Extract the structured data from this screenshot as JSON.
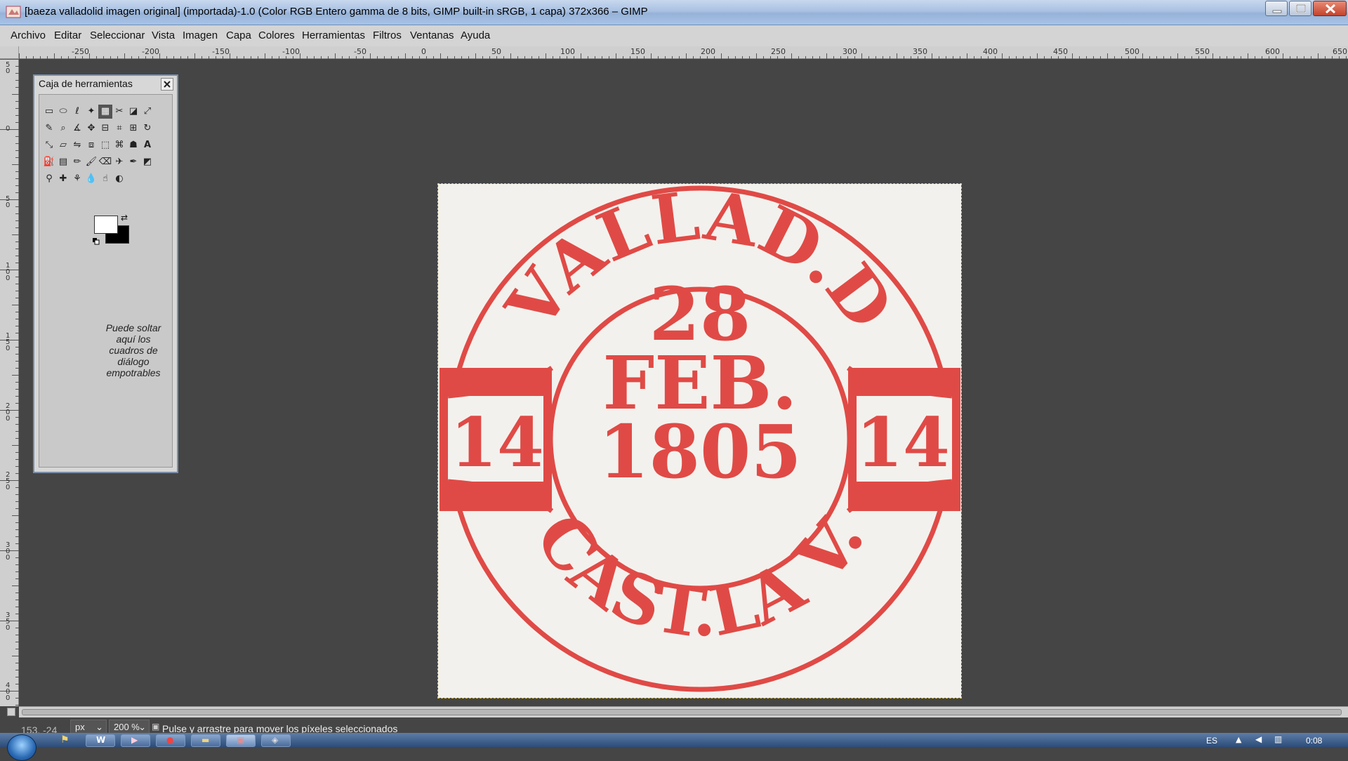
{
  "window": {
    "title": "[baeza valladolid imagen original] (importada)-1.0 (Color RGB Entero gamma de 8 bits, GIMP built-in sRGB, 1 capa) 372x366 – GIMP"
  },
  "menu": [
    "Archivo",
    "Editar",
    "Seleccionar",
    "Vista",
    "Imagen",
    "Capa",
    "Colores",
    "Herramientas",
    "Filtros",
    "Ventanas",
    "Ayuda"
  ],
  "ruler": {
    "h_labels": [
      "-250",
      "-200",
      "-150",
      "-100",
      "-50",
      "0",
      "50",
      "100",
      "150",
      "200",
      "250",
      "300",
      "350",
      "400",
      "450",
      "500",
      "550",
      "600",
      "650"
    ],
    "v_labels": [
      "50",
      "0",
      "50",
      "100",
      "150",
      "200",
      "250",
      "300",
      "350",
      "400"
    ]
  },
  "toolbox": {
    "title": "Caja de herramientas",
    "drop_hint": "Puede soltar aquí los cuadros de diálogo empotrables",
    "foreground_color": "#ffffff",
    "background_color": "#000000"
  },
  "image": {
    "stamp_color": "#e04a46",
    "top_text": "VALLAD.D",
    "left_number": "14",
    "right_number": "14",
    "day": "28",
    "month": "FEB.",
    "year": "1805",
    "bottom_text": "CAST.LA V."
  },
  "status": {
    "coords": "153, -24",
    "unit": "px",
    "zoom": "200 %",
    "message": "Pulse y arrastre para mover los píxeles seleccionados"
  },
  "taskbar": {
    "language": "ES",
    "clock": "0:08"
  }
}
